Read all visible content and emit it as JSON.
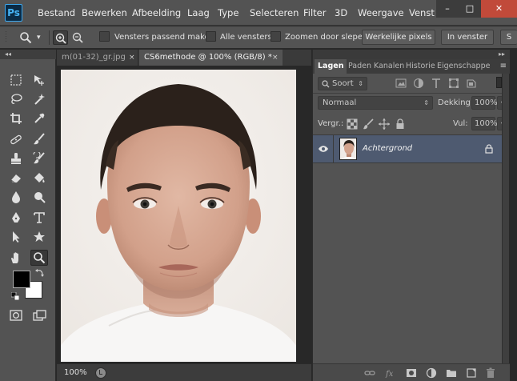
{
  "app": {
    "logo": "Ps"
  },
  "menu": [
    "Bestand",
    "Bewerken",
    "Afbeelding",
    "Laag",
    "Type",
    "Selecteren",
    "Filter",
    "3D",
    "Weergave",
    "Venst"
  ],
  "window_controls": {
    "minimize": "–",
    "maximize": "□",
    "close": "✕"
  },
  "options_bar": {
    "tool_icon": "zoom-icon",
    "tool_caret": "▾",
    "checkbox_resize": "Vensters passend maken",
    "checkbox_all": "Alle vensters",
    "checkbox_scrubby": "Zoomen door slepen",
    "btn_actual": "Werkelijke pixels",
    "btn_fit": "In venster",
    "btn_fill": "S"
  },
  "tools_panel": {
    "collapse": "◂◂"
  },
  "document_tabs": [
    {
      "label": "m(01-32)_gr.jpg",
      "close": "×"
    },
    {
      "label": "CS6methode @ 100% (RGB/8) *",
      "close": "×"
    }
  ],
  "status_bar": {
    "zoom": "100%"
  },
  "layers_panel": {
    "collapse": "▸▸",
    "tabs": [
      "Lagen",
      "Paden",
      "Kanalen",
      "Historie",
      "Eigenschappe"
    ],
    "menu_icon": "≡",
    "filter_kind": "Soort",
    "blend_mode": "Normaal",
    "opacity_label": "Dekking:",
    "opacity_value": "100%",
    "lock_label": "Vergr.:",
    "fill_label": "Vul:",
    "fill_value": "100%",
    "layer_name": "Achtergrond"
  },
  "colors": {
    "menubar": "#535353",
    "panel": "#535353",
    "selected_layer": "#4e5a70",
    "close_button": "#c14a3a",
    "foreground": "#000000",
    "background": "#ffffff"
  }
}
